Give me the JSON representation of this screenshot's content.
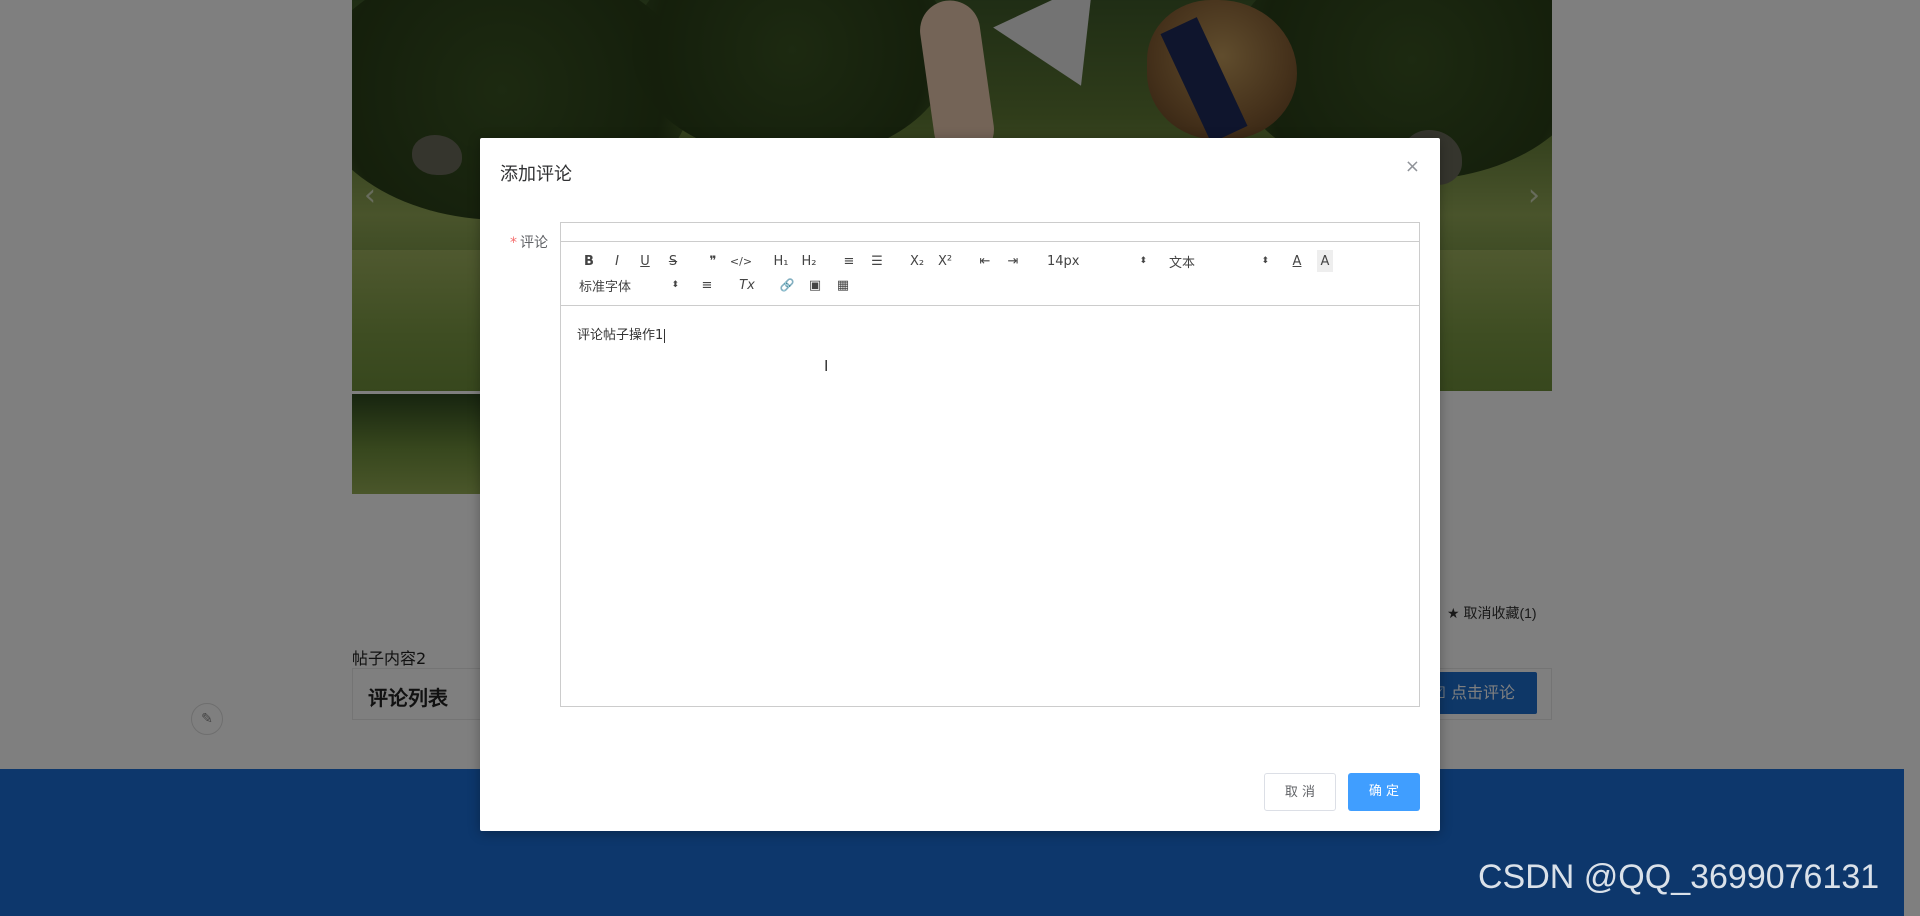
{
  "page": {
    "favorite_text": "取消收藏(1)",
    "post_content": "帖子内容2",
    "comment_list_title": "评论列表",
    "click_comment_label": "点击评论"
  },
  "dialog": {
    "title": "添加评论",
    "close": "×",
    "field_label": "评论",
    "required_mark": "*",
    "content": "评论帖子操作1",
    "cancel_label": "取 消",
    "ok_label": "确 定"
  },
  "toolbar": {
    "bold": "B",
    "italic": "I",
    "underline": "U",
    "strike": "S",
    "blockquote": "❞",
    "code_block": "</>",
    "h1": "H₁",
    "h2": "H₂",
    "ordered_list": "≡",
    "bullet_list": "☰",
    "subscript": "X₂",
    "superscript": "X²",
    "outdent": "⇤",
    "indent": "⇥",
    "size_value": "14px",
    "header_value": "文本",
    "color": "A",
    "background": "A",
    "font_value": "标准字体",
    "align": "≡",
    "clean": "Tx",
    "link": "🔗",
    "image": "▣",
    "video": "▦"
  },
  "colors": {
    "primary": "#409eff",
    "footer": "#1a6fd9",
    "comment_button": "#1d6fcf",
    "required": "#f56c6c"
  },
  "watermark": "CSDN @QQ_3699076131"
}
